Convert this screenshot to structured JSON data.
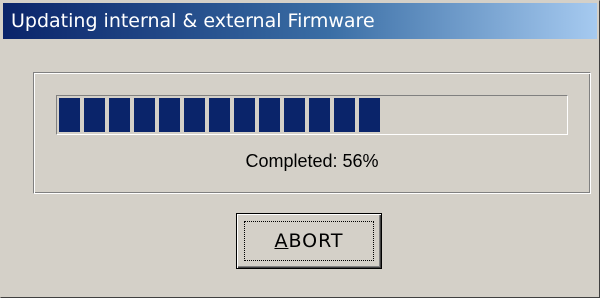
{
  "window": {
    "title": "Updating internal & external Firmware"
  },
  "progress": {
    "percent": 56,
    "total_blocks": 24,
    "status_text": "Completed: 56%"
  },
  "abort_button": {
    "accel_letter": "A",
    "label_rest": "BORT"
  },
  "colors": {
    "titlebar_start": "#0a246a",
    "titlebar_end": "#a6caf0",
    "progress_fill": "#0a246a",
    "face": "#d4d0c8"
  }
}
